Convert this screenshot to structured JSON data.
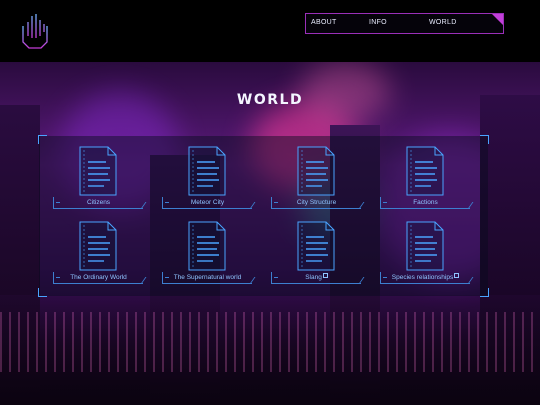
{
  "nav": {
    "items": [
      {
        "label": "ABOUT"
      },
      {
        "label": "INFO"
      },
      {
        "label": "WORLD"
      }
    ]
  },
  "page": {
    "title": "WORLD"
  },
  "cards": [
    {
      "label": "Citizens",
      "external": false
    },
    {
      "label": "Meteor City",
      "external": false
    },
    {
      "label": "City Structure",
      "external": false
    },
    {
      "label": "Factions",
      "external": false
    },
    {
      "label": "The Ordinary World",
      "external": false
    },
    {
      "label": "The Supernatural world",
      "external": false
    },
    {
      "label": "Slang",
      "external": true
    },
    {
      "label": "Species relationships",
      "external": true
    }
  ],
  "colors": {
    "accent": "#3d7fd0",
    "nav_border": "#9a2fb8",
    "nav_corner": "#c23fd8",
    "title": "#f4f6ff"
  }
}
